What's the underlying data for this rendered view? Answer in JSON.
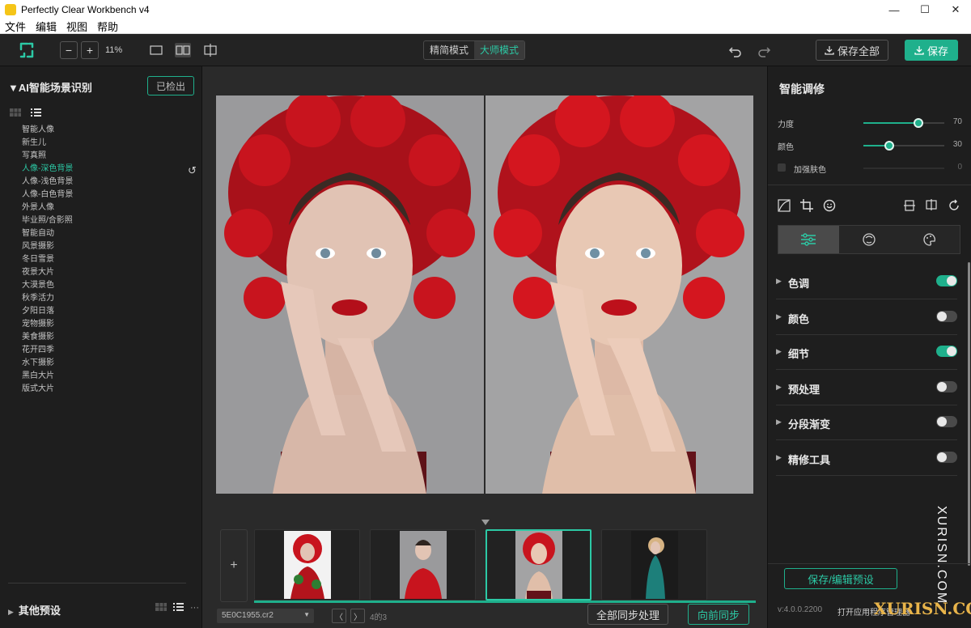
{
  "window": {
    "title": "Perfectly Clear Workbench v4",
    "controls": [
      "—",
      "☐",
      "✕"
    ]
  },
  "menu": [
    "文件",
    "编辑",
    "视图",
    "帮助"
  ],
  "toolbar": {
    "zoom_value": "11%",
    "zoom_out": "−",
    "zoom_in": "+",
    "mode_simple": "精简模式",
    "mode_master": "大师模式",
    "save_all": "保存全部",
    "save": "保存"
  },
  "left": {
    "section_title": "AI智能场景识别",
    "detected_button": "已检出",
    "scenes": [
      "智能人像",
      "新生儿",
      "写真照",
      "人像-深色背景",
      "人像-浅色背景",
      "人像-白色背景",
      "外景人像",
      "毕业照/合影照",
      "智能自动",
      "风景摄影",
      "冬日雪景",
      "夜景大片",
      "大漠景色",
      "秋季活力",
      "夕阳日落",
      "宠物摄影",
      "美食摄影",
      "花开四季",
      "水下摄影",
      "黑白大片",
      "版式大片"
    ],
    "active_scene_index": 3,
    "other_presets": "其他预设"
  },
  "center": {
    "file_name": "5E0C1955.cr2",
    "count": "4的3",
    "sync_all": "全部同步处理",
    "sync_forward": "向前同步",
    "add": "+"
  },
  "right": {
    "title": "智能调修",
    "sliders": [
      {
        "label": "力度",
        "value": "70",
        "fraction": 0.68
      },
      {
        "label": "颜色",
        "value": "30",
        "fraction": 0.32
      },
      {
        "label": "加强肤色",
        "value": "0",
        "fraction": 0
      }
    ],
    "sections": [
      {
        "name": "色调",
        "on": true
      },
      {
        "name": "颜色",
        "on": false
      },
      {
        "name": "细节",
        "on": true
      },
      {
        "name": "预处理",
        "on": false
      },
      {
        "name": "分段渐变",
        "on": false
      },
      {
        "name": "精修工具",
        "on": false
      }
    ],
    "save_preset": "保存/编辑预设",
    "version": "v:4.0.0.2200",
    "open_app": "打开应用程序管理器"
  },
  "watermark": {
    "vertical": "XURISN.COM",
    "horizontal": "XURISN.COM"
  },
  "colors": {
    "accent": "#1fb08c",
    "accent_text": "#2cc9a5",
    "background": "#1e1e1e"
  }
}
